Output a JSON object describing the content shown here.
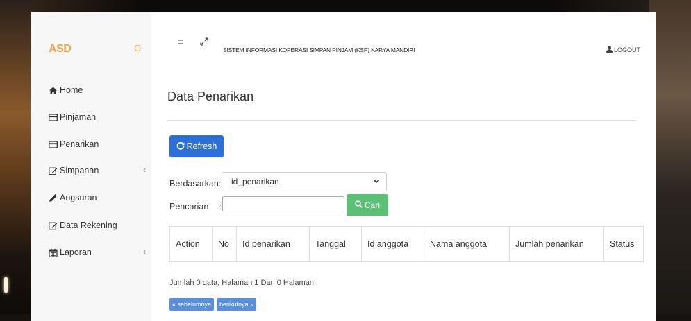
{
  "brand": {
    "name": "ASD",
    "toggle": "O"
  },
  "sidebar": {
    "items": [
      {
        "label": "Home",
        "icon": "home-icon"
      },
      {
        "label": "Pinjaman",
        "icon": "credit-card-icon"
      },
      {
        "label": "Penarikan",
        "icon": "credit-card-icon"
      },
      {
        "label": "Simpanan",
        "icon": "edit-icon",
        "caret": "‹"
      },
      {
        "label": "Angsuran",
        "icon": "pencil-icon"
      },
      {
        "label": "Data Rekening",
        "icon": "edit-icon"
      },
      {
        "label": "Laporan",
        "icon": "calendar-icon",
        "caret": "‹"
      }
    ]
  },
  "topbar": {
    "menu_icon": "≡",
    "expand_icon": "⤢",
    "title": "SISTEM INFORMASI KOPERASI SIMPAN PINJAM (KSP) KARYA MANDIRI",
    "logout": "LOGOUT"
  },
  "page": {
    "title": "Data Penarikan",
    "refresh_label": "Refresh",
    "filter_label": "Berdasarkan:",
    "filter_value": "id_penarikan",
    "search_label": "Pencarian",
    "search_colon": ":",
    "search_value": "",
    "search_button": "Cari"
  },
  "table": {
    "headers": [
      "Action",
      "No",
      "Id penarikan",
      "Tanggal",
      "Id anggota",
      "Nama anggota",
      "Jumlah penarikan",
      "Status"
    ]
  },
  "pagination": {
    "summary": "Jumlah 0 data, Halaman 1 Dari 0 Halaman",
    "prev": "« sebelumnya",
    "next": "berikutnya »"
  },
  "colors": {
    "brand": "#f0a64e",
    "primary": "#2a70d6",
    "success": "#5cbf76",
    "pager": "#5b8fdc"
  }
}
